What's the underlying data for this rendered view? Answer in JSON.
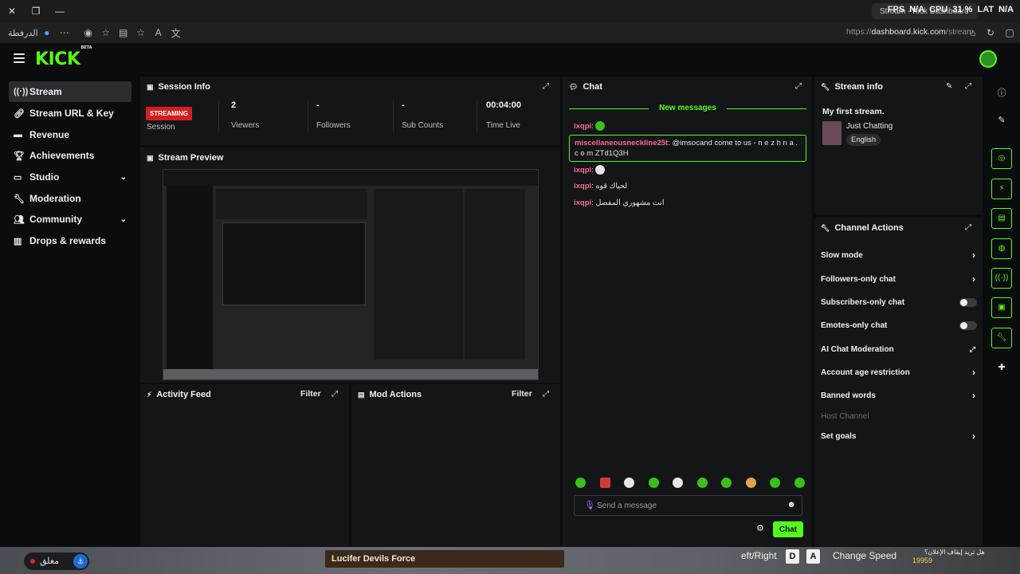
{
  "hud": {
    "fps_label": "FPS",
    "fps_value": "N/A",
    "cpu_label": "CPU",
    "cpu_value": "31 %",
    "lat_label": "LAT",
    "lat_value": "N/A",
    "tab_title": "Stream - Kick Dashboard"
  },
  "browser": {
    "home_label": "الدرفطة",
    "url_prefix": "https://",
    "url_host": "dashboard.kick.com",
    "url_path": "/stream"
  },
  "brand": {
    "logo": "KICK",
    "beta": "BETA"
  },
  "sidebar": {
    "items": [
      {
        "label": "Stream",
        "icon": "broadcast-icon"
      },
      {
        "label": "Stream URL & Key",
        "icon": "link-icon"
      },
      {
        "label": "Revenue",
        "icon": "wallet-icon"
      },
      {
        "label": "Achievements",
        "icon": "trophy-icon"
      },
      {
        "label": "Studio",
        "icon": "studio-icon"
      },
      {
        "label": "Moderation",
        "icon": "wrench-icon"
      },
      {
        "label": "Community",
        "icon": "users-icon"
      },
      {
        "label": "Drops & rewards",
        "icon": "gift-icon"
      }
    ]
  },
  "session": {
    "title": "Session Info",
    "badge": "STREAMING",
    "badge_label": "Session",
    "stats": [
      {
        "value": "2",
        "label": "Viewers"
      },
      {
        "value": "-",
        "label": "Followers"
      },
      {
        "value": "-",
        "label": "Sub Counts"
      },
      {
        "value": "00:04:00",
        "label": "Time Live"
      }
    ]
  },
  "preview": {
    "title": "Stream Preview"
  },
  "activity": {
    "title": "Activity Feed",
    "filter": "Filter"
  },
  "mod_actions": {
    "title": "Mod Actions",
    "filter": "Filter"
  },
  "chat": {
    "title": "Chat",
    "new_messages": "New messages",
    "messages": [
      {
        "user": "ixqpi",
        "text": ""
      },
      {
        "user": "miscellaneousneckline25t",
        "text": " @imsocand come to us - n e z h n a . c o m ZTd1Q3H"
      },
      {
        "user": "ixqpi",
        "text": ""
      },
      {
        "user": "ixqpi",
        "text": " لحياك قوه"
      },
      {
        "user": "ixqpi",
        "text": " انت مشهوري المفضل"
      }
    ],
    "placeholder": "Send a message",
    "send_label": "Chat"
  },
  "stream_info": {
    "title": "Stream info",
    "stream_title": "My first stream.",
    "category": "Just Chatting",
    "language": "English"
  },
  "channel_actions": {
    "title": "Channel Actions",
    "items": [
      {
        "label": "Slow mode",
        "control": "chevron"
      },
      {
        "label": "Followers-only chat",
        "control": "chevron"
      },
      {
        "label": "Subscribers-only chat",
        "control": "toggle"
      },
      {
        "label": "Emotes-only chat",
        "control": "toggle"
      },
      {
        "label": "AI Chat Moderation",
        "control": "external"
      },
      {
        "label": "Account age restriction",
        "control": "chevron"
      },
      {
        "label": "Banned words",
        "control": "chevron"
      },
      {
        "label": "Host Channel",
        "control": "disabled"
      },
      {
        "label": "Set goals",
        "control": "chevron"
      }
    ]
  },
  "bottom": {
    "closed_label": "مغلق",
    "banner": "Lucifer Devils Force",
    "lr_text": "eft/Right",
    "key_d": "D",
    "key_a": "A",
    "change_speed": "Change Speed",
    "arabic_note": "هل تريد إيقاف الإعلان؟",
    "coins": "19959"
  },
  "colors": {
    "accent": "#53fc18",
    "live": "#d41e1e",
    "username": "#ff6b8f"
  }
}
